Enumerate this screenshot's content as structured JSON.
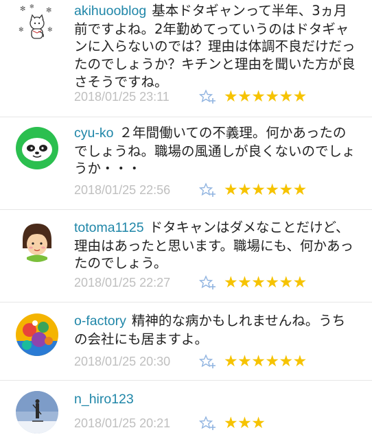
{
  "comments": [
    {
      "username": "akihuooblog",
      "text": "基本ドタギャンって半年、3ヵ月前ですよね。2年勤めてっていうのはドタギャンに入らないのでは？理由は体調不良だけだったのでしょうか？キチンと理由を聞いた方が良さそうですね。",
      "timestamp": "2018/01/25 23:11",
      "stars": "★★★★★★",
      "star_count": 6
    },
    {
      "username": "cyu-ko",
      "text": "２年間働いての不義理。何かあったのでしょうね。職場の風通しが良くないのでしょうか・・・",
      "timestamp": "2018/01/25 22:56",
      "stars": "★★★★★★",
      "star_count": 6
    },
    {
      "username": "totoma1125",
      "text": "ドタキャンはダメなことだけど、理由はあったと思います。職場にも、何かあったのでしょう。",
      "timestamp": "2018/01/25 22:27",
      "stars": "★★★★★★",
      "star_count": 6
    },
    {
      "username": "o-factory",
      "text": "精神的な病かもしれませんね。うちの会社にも居ますよ。",
      "timestamp": "2018/01/25 20:30",
      "stars": "★★★★★★",
      "star_count": 6
    },
    {
      "username": "n_hiro123",
      "text": "",
      "timestamp": "2018/01/25 20:21",
      "stars": "★★★",
      "star_count": 3
    }
  ],
  "colors": {
    "username": "#1f86a8",
    "body_text": "#222222",
    "timestamp": "#bfbfbf",
    "star": "#f6c300",
    "add_star": "#8fb3e0",
    "divider": "#e6e6e6"
  },
  "icons": {
    "add_star": "add-star-icon"
  }
}
